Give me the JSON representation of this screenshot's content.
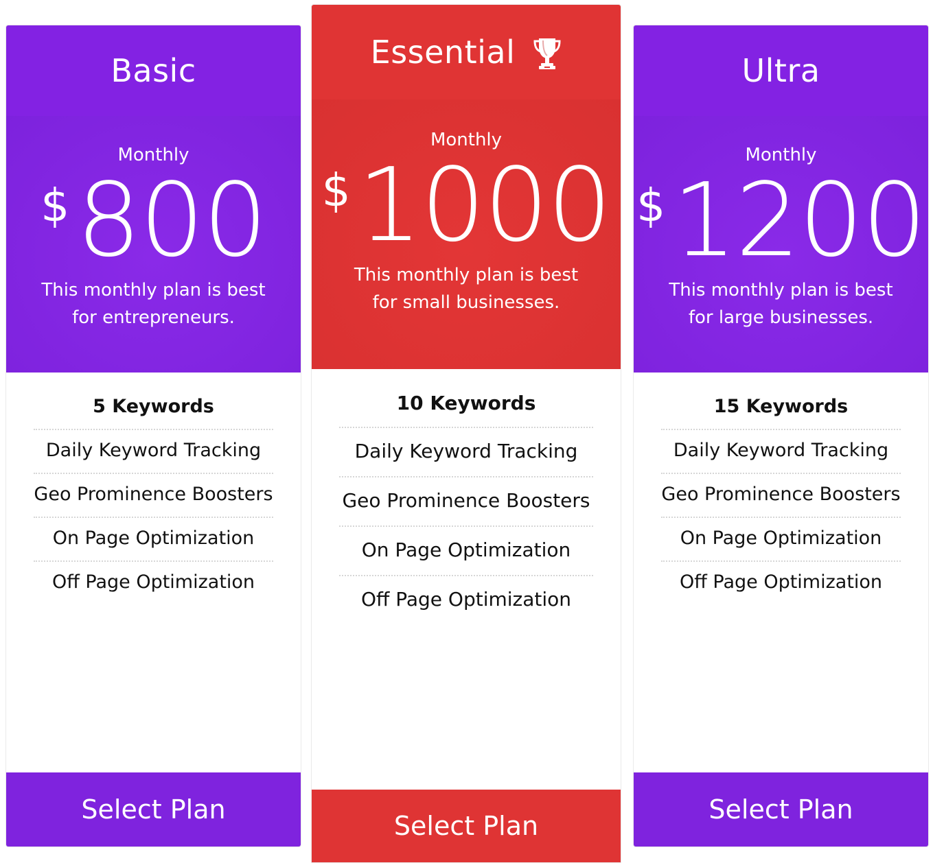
{
  "plans": [
    {
      "title": "Basic",
      "period": "Monthly",
      "currency": "$",
      "price": "800",
      "description": "This monthly plan is best for entrepreneurs.",
      "features": [
        "5 Keywords",
        "Daily Keyword Tracking",
        "Geo Prominence Boosters",
        "On Page Optimization",
        "Off Page Optimization"
      ],
      "button_label": "Select Plan"
    },
    {
      "title": "Essential",
      "badge_icon": "trophy-icon",
      "period": "Monthly",
      "currency": "$",
      "price": "1000",
      "description": "This monthly plan is best for small businesses.",
      "features": [
        "10 Keywords",
        "Daily Keyword Tracking",
        "Geo Prominence Boosters",
        "On Page Optimization",
        "Off Page Optimization"
      ],
      "button_label": "Select Plan"
    },
    {
      "title": "Ultra",
      "period": "Monthly",
      "currency": "$",
      "price": "1200",
      "description": "This monthly plan is best for large businesses.",
      "features": [
        "15 Keywords",
        "Daily Keyword Tracking",
        "Geo Prominence Boosters",
        "On Page Optimization",
        "Off Page Optimization"
      ],
      "button_label": "Select Plan"
    }
  ],
  "colors": {
    "purple": "#8322e3",
    "red": "#e03434",
    "white": "#ffffff"
  }
}
